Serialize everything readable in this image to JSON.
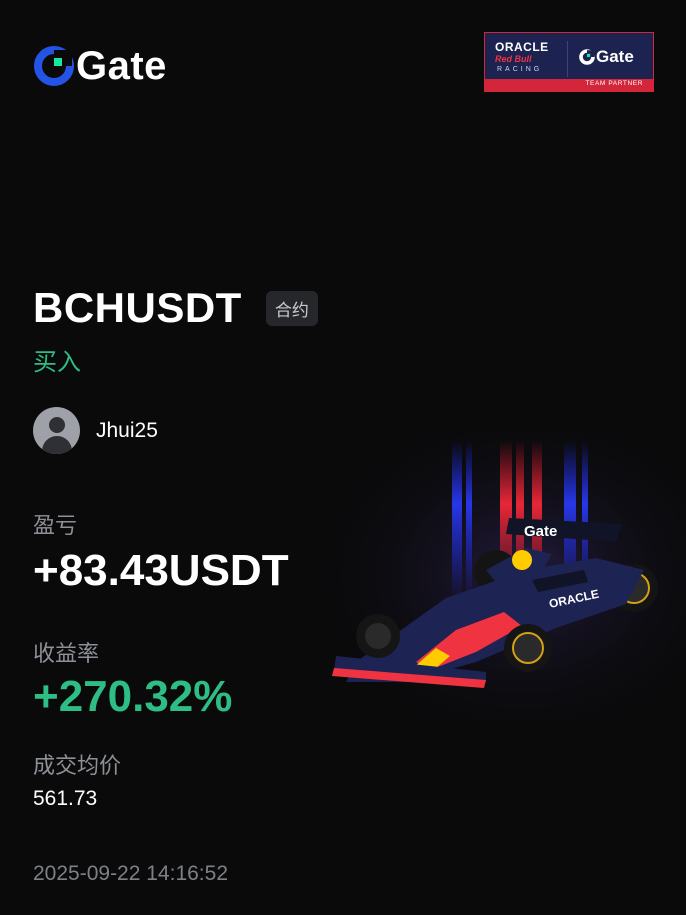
{
  "brand": {
    "logo_text": "Gate",
    "accent": "#2354e6",
    "accent_green": "#17e5a1"
  },
  "partner_badge": {
    "oracle": "ORACLE",
    "red_bull": "Red Bull",
    "racing": "RACING",
    "gate": "Gate",
    "strip": "TEAM PARTNER"
  },
  "position": {
    "pair": "BCHUSDT",
    "type_tag": "合约",
    "side": "买入",
    "side_color": "#2ebd85"
  },
  "user": {
    "name": "Jhui25"
  },
  "stats": {
    "pnl_label": "盈亏",
    "pnl_value": "+83.43USDT",
    "roi_label": "收益率",
    "roi_value": "+270.32%",
    "avg_price_label": "成交均价",
    "avg_price_value": "561.73"
  },
  "timestamp": "2025-09-22 14:16:52"
}
